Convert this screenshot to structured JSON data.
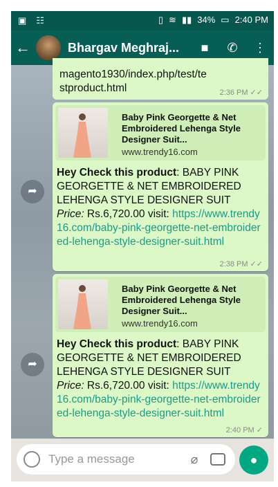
{
  "status": {
    "sim": "▣",
    "net": "☷",
    "battery": "34%",
    "time": "2:40 PM"
  },
  "header": {
    "title": "Bhargav Meghraj..."
  },
  "top_message": {
    "link_tail": "magento1930/index.php/test/testproduct.html",
    "time": "2:36 PM ✓✓"
  },
  "messages": [
    {
      "preview_title": "Baby Pink Georgette & Net Embroidered Lehenga Style Designer Suit...",
      "preview_domain": "www.trendy16.com",
      "bold": "Hey Check this product",
      "body": ":  BABY PINK GEORGETTE & NET EMBROIDERED LEHENGA STYLE DESIGNER SUIT",
      "price_label": "Price:",
      "price_value": " Rs.6,720.00  visit: ",
      "link": "https://www.trendy16.com/baby-pink-georgette-net-embroidered-lehenga-style-designer-suit.html",
      "time": "2:38 PM ✓✓"
    },
    {
      "preview_title": "Baby Pink Georgette & Net Embroidered Lehenga Style Designer Suit...",
      "preview_domain": "www.trendy16.com",
      "bold": "Hey Check this product",
      "body": ":  BABY PINK GEORGETTE & NET EMBROIDERED LEHENGA STYLE DESIGNER SUIT",
      "price_label": "Price:",
      "price_value": " Rs.6,720.00  visit: ",
      "link": "https://www.trendy16.com/baby-pink-georgette-net-embroidered-lehenga-style-designer-suit.html",
      "time": "2:40 PM ✓"
    }
  ],
  "input": {
    "placeholder": "Type a message"
  }
}
